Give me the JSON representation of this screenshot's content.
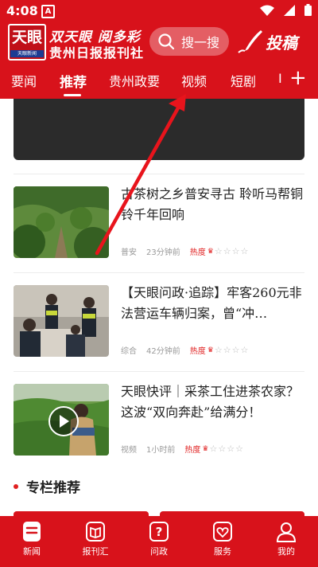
{
  "status_bar": {
    "time": "4:08",
    "badge": "A"
  },
  "header": {
    "logo_text": "天眼",
    "logo_sub": "天眼新闻",
    "brand_top": "双天眼  阅多彩",
    "brand_bottom": "贵州日报报刊社",
    "search_placeholder": "搜一搜",
    "submit_label": "投稿"
  },
  "tabs": [
    {
      "label": "要闻"
    },
    {
      "label": "推荐",
      "active": true
    },
    {
      "label": "贵州政要"
    },
    {
      "label": "视频"
    },
    {
      "label": "短剧"
    },
    {
      "label": "I"
    }
  ],
  "news": [
    {
      "title": "古茶树之乡普安寻古  聆听马帮铜铃千年回响",
      "tag": "普安",
      "time": "23分钟前",
      "hot_label": "热度",
      "hot_stars": 0
    },
    {
      "title": "【天眼问政·追踪】牢客260元非法营运车辆归案，曾“冲…",
      "tag": "综合",
      "time": "42分钟前",
      "hot_label": "热度",
      "hot_stars": 0
    },
    {
      "title": "天眼快评｜采茶工住进茶农家？这波“双向奔赴”给满分！",
      "tag": "视频",
      "time": "1小时前",
      "hot_label": "热度",
      "hot_stars": 0
    }
  ],
  "section": {
    "title": "专栏推荐"
  },
  "bottom_nav": [
    {
      "label": "新闻",
      "icon": "news-icon"
    },
    {
      "label": "报刊汇",
      "icon": "book-icon"
    },
    {
      "label": "问政",
      "icon": "question-icon"
    },
    {
      "label": "服务",
      "icon": "heart-icon"
    },
    {
      "label": "我的",
      "icon": "user-icon"
    }
  ],
  "colors": {
    "primary": "#d8121b",
    "hot": "#e02020",
    "annotation": "#e8141c"
  }
}
